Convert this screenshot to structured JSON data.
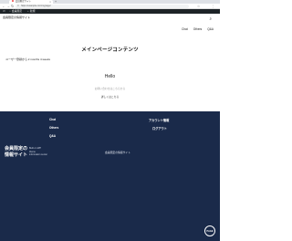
{
  "browser": {
    "tab_title": "会員限定サイト",
    "tab_close": "×",
    "new_tab": "+",
    "url": "https://example.com/mypage/",
    "back": "←",
    "forward": "→",
    "reload": "↻",
    "lock": "🔒",
    "tools": [
      "☆",
      "⋮"
    ]
  },
  "adminbar": {
    "wp_logo": "W",
    "site_name": "会員限定",
    "new_label": "新規"
  },
  "header": {
    "site_title": "会員限定の情報サイト",
    "search_icon": "⌕",
    "nav": [
      "Chat",
      "Others",
      "Q&A"
    ]
  },
  "main": {
    "heading": "メインページコンテンツ",
    "user_line": "ユーザー登録から 2 months 4 weeks",
    "hello": "Hello",
    "hello_sub": "お問い合わせはこちらから",
    "hello_link": "詳しくはこちら"
  },
  "footer": {
    "links_left": [
      "Chat",
      "Others",
      "Q&A"
    ],
    "links_right": [
      "アカウント情報",
      "ログアウト"
    ],
    "brand_line1": "会員限定の",
    "brand_line2": "情報サイト",
    "meta": [
      "Built on WP",
      "theme",
      "information center"
    ],
    "copyright": "会員限定の情報サイト"
  },
  "fab": {
    "label": "PAGE TOP"
  }
}
